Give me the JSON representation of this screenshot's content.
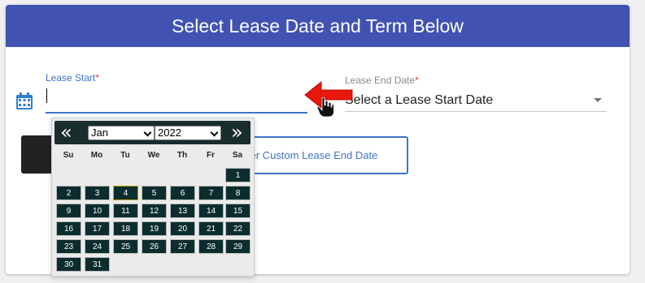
{
  "header": {
    "title": "Select Lease Date and Term Below"
  },
  "lease_start": {
    "label": "Lease Start",
    "required_mark": "*",
    "value": "",
    "icon": "calendar-icon"
  },
  "lease_end": {
    "label": "Lease End Date",
    "required_mark": "*",
    "selected": "Select a Lease Start Date"
  },
  "custom_end_button": {
    "label": "Enter Custom Lease End Date"
  },
  "datepicker": {
    "prev_label": "«",
    "next_label": "»",
    "month": "Jan",
    "year": "2022",
    "weekdays": [
      "Su",
      "Mo",
      "Tu",
      "We",
      "Th",
      "Fr",
      "Sa"
    ],
    "first_weekday_index": 6,
    "days": [
      "1",
      "2",
      "3",
      "4",
      "5",
      "6",
      "7",
      "8",
      "9",
      "10",
      "11",
      "12",
      "13",
      "14",
      "15",
      "16",
      "17",
      "18",
      "19",
      "20",
      "21",
      "22",
      "23",
      "24",
      "25",
      "26",
      "27",
      "28",
      "29",
      "30",
      "31"
    ],
    "highlighted_day": "4"
  },
  "colors": {
    "header_bg": "#4152b3",
    "accent_blue": "#3f74c7",
    "required_red": "#e53935",
    "day_cell_bg": "#0c2d2d",
    "arrow_red": "#e8160b"
  }
}
